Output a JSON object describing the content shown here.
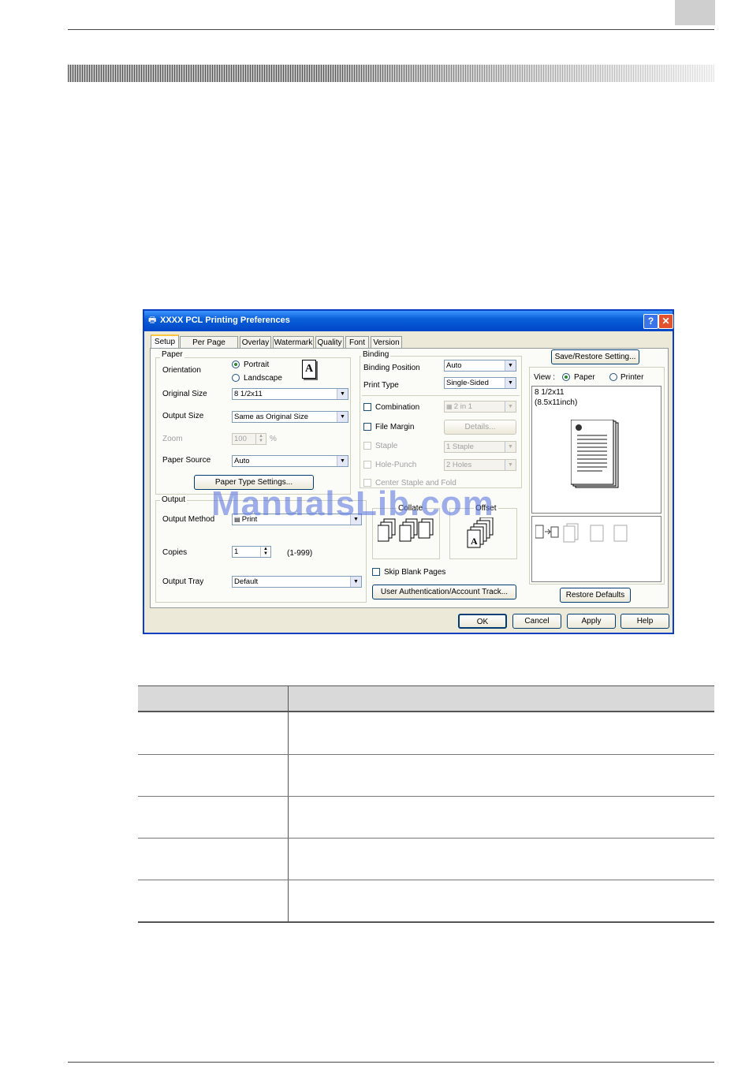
{
  "dialog": {
    "title": "XXXX PCL Printing Preferences",
    "help_glyph": "?",
    "close_glyph": "✕",
    "tabs": [
      "Setup",
      "Per Page Setting",
      "Overlay",
      "Watermark",
      "Quality",
      "Font",
      "Version"
    ],
    "active_tab": "Setup",
    "paper": {
      "group_label": "Paper",
      "orientation_label": "Orientation",
      "portrait_label": "Portrait",
      "landscape_label": "Landscape",
      "orientation_selected": "Portrait",
      "orientation_icon_glyph": "A",
      "original_size_label": "Original Size",
      "original_size_value": "8 1/2x11",
      "output_size_label": "Output Size",
      "output_size_value": "Same as Original Size",
      "zoom_label": "Zoom",
      "zoom_value": "100",
      "zoom_unit": "%",
      "paper_source_label": "Paper Source",
      "paper_source_value": "Auto",
      "paper_type_button": "Paper Type Settings..."
    },
    "output": {
      "group_label": "Output",
      "output_method_label": "Output Method",
      "output_method_value": "Print",
      "copies_label": "Copies",
      "copies_value": "1",
      "copies_range": "(1-999)",
      "output_tray_label": "Output Tray",
      "output_tray_value": "Default",
      "collate_label": "Collate",
      "offset_label": "Offset",
      "skip_blank_label": "Skip Blank Pages",
      "user_auth_button": "User Authentication/Account Track..."
    },
    "binding": {
      "group_label": "Binding",
      "binding_position_label": "Binding Position",
      "binding_position_value": "Auto",
      "print_type_label": "Print Type",
      "print_type_value": "Single-Sided",
      "combination_label": "Combination",
      "combination_value": "2 in 1",
      "file_margin_label": "File Margin",
      "details_button": "Details...",
      "staple_label": "Staple",
      "staple_value": "1 Staple",
      "hole_punch_label": "Hole-Punch",
      "hole_punch_value": "2 Holes",
      "center_staple_label": "Center Staple and Fold"
    },
    "preview": {
      "save_restore_button": "Save/Restore Setting...",
      "view_label": "View :",
      "view_paper_label": "Paper",
      "view_printer_label": "Printer",
      "view_selected": "Paper",
      "size_line1": "8 1/2x11",
      "size_line2": "(8.5x11inch)",
      "restore_defaults_button": "Restore Defaults"
    },
    "buttons": {
      "ok": "OK",
      "cancel": "Cancel",
      "apply": "Apply",
      "help": "Help"
    }
  },
  "watermark_text": "ManualsLib.com",
  "colors": {
    "titlebar": "#0a5fd8",
    "dialog_face": "#ece9d8",
    "tab_highlight": "#ffc83c",
    "table_header": "#d9d9d9"
  }
}
